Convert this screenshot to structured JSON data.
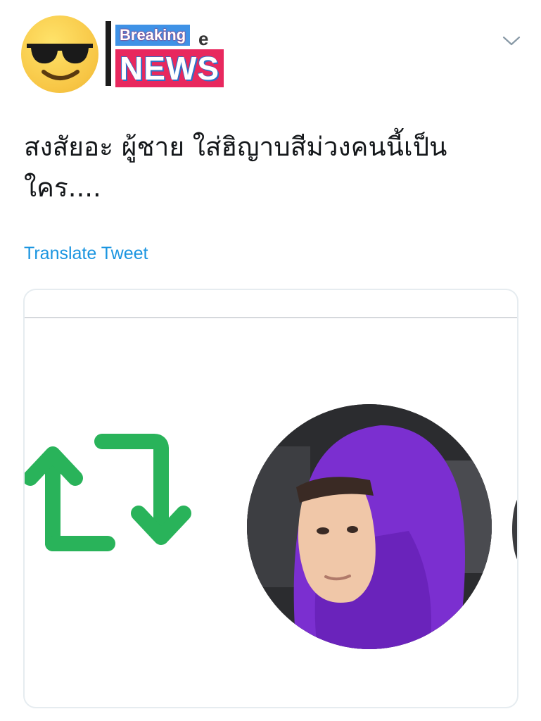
{
  "header": {
    "avatar_icon": "sunglasses-emoji-icon",
    "name_partial": "e",
    "overlay": {
      "breaking": "Breaking",
      "news": "NEWS"
    },
    "menu_icon": "chevron-down-icon"
  },
  "tweet": {
    "text": "สงสัยอะ ผู้ชาย ใส่ฮิญาบสีม่วงคนนี้เป็นใคร....",
    "translate_label": "Translate Tweet"
  },
  "media": {
    "icons": [
      "retweet-icon"
    ],
    "colors": {
      "retweet_green": "#29b35a",
      "hood_purple": "#7b2fd0",
      "link_blue": "#1b95e0",
      "breaking_blue": "#3f92e6",
      "news_red": "#e8285e"
    }
  }
}
